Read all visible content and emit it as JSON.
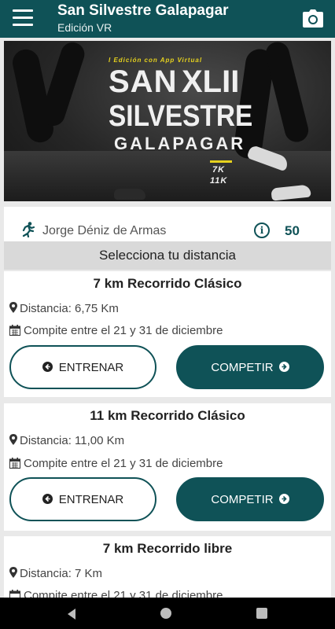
{
  "appbar": {
    "title": "San Silvestre Galapagar",
    "subtitle": "Edición VR"
  },
  "banner": {
    "edition_text": "I Edición con App Virtual",
    "title_line1": "SAN",
    "roman_numeral": "XLII",
    "title_line2": "SILVESTRE",
    "title_line3": "GALAPAGAR",
    "distance_a": "7K",
    "distance_b": "11K"
  },
  "runner": {
    "name": "Jorge Déniz de Armas",
    "count": "50"
  },
  "select_header": "Selecciona tu distancia",
  "cards": [
    {
      "title": "7 km Recorrido Clásico",
      "distance": "Distancia: 6,75 Km",
      "dates": "Compite entre el 21 y 31 de diciembre",
      "train_label": "ENTRENAR",
      "compete_label": "COMPETIR"
    },
    {
      "title": "11 km Recorrido Clásico",
      "distance": "Distancia: 11,00 Km",
      "dates": "Compite entre el 21 y 31 de diciembre",
      "train_label": "ENTRENAR",
      "compete_label": "COMPETIR"
    },
    {
      "title": "7 km Recorrido libre",
      "distance": "Distancia: 7 Km",
      "dates": "Compite entre el 21 y 31 de diciembre"
    }
  ],
  "colors": {
    "primary": "#0f5257",
    "banner_accent": "#e6d21e"
  },
  "icons": [
    "menu-icon",
    "camera-icon",
    "runner-icon",
    "info-icon",
    "location-pin-icon",
    "calendar-icon",
    "arrow-left-icon",
    "arrow-right-icon"
  ]
}
